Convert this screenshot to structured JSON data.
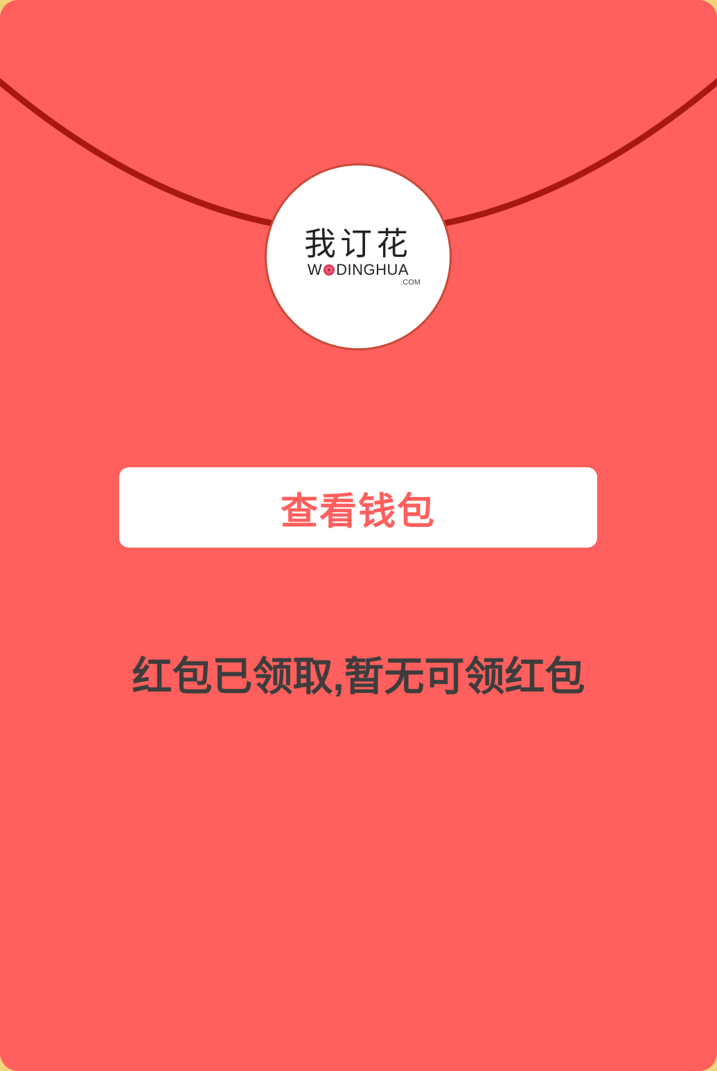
{
  "envelope": {
    "background_color": "#ff5f5d",
    "flap_line_color": "#a8180f",
    "outer_color": "#f3d37a"
  },
  "seal": {
    "logo_cn": "我订花",
    "logo_en_prefix": "W",
    "logo_en_suffix": "DINGHUA",
    "logo_com": ".COM",
    "rose_icon": "rose-icon"
  },
  "wallet_button": {
    "label": "查看钱包",
    "text_color": "#ff5f5d"
  },
  "status": {
    "message": "红包已领取,暂无可领红包"
  }
}
